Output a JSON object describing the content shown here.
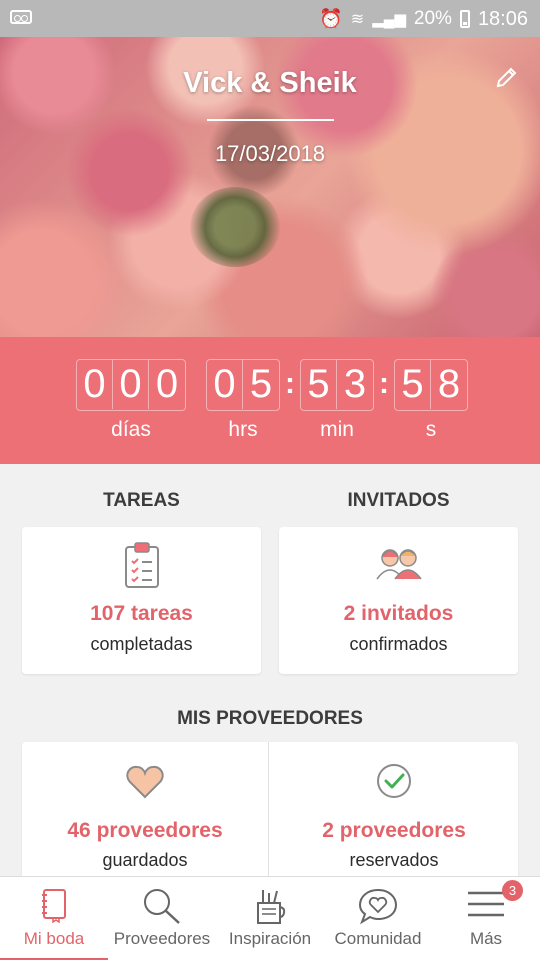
{
  "status_bar": {
    "battery": "20%",
    "time": "18:06"
  },
  "hero": {
    "couple_names": "Vick & Sheik",
    "wedding_date": "17/03/2018"
  },
  "countdown": {
    "days": [
      "0",
      "0",
      "0"
    ],
    "hours": [
      "0",
      "5"
    ],
    "minutes": [
      "5",
      "3"
    ],
    "seconds": [
      "5",
      "8"
    ],
    "labels": {
      "days": "días",
      "hours": "hrs",
      "minutes": "min",
      "seconds": "s"
    }
  },
  "tasks": {
    "title": "TAREAS",
    "count": "107 tareas",
    "caption": "completadas"
  },
  "guests": {
    "title": "INVITADOS",
    "count": "2 invitados",
    "caption": "confirmados"
  },
  "vendors": {
    "title": "MIS PROVEEDORES",
    "saved_count": "46 proveedores",
    "saved_caption": "guardados",
    "booked_count": "2 proveedores",
    "booked_caption": "reservados"
  },
  "nav": {
    "items": [
      {
        "label": "Mi boda",
        "icon": "notebook-icon"
      },
      {
        "label": "Proveedores",
        "icon": "search-icon"
      },
      {
        "label": "Inspiración",
        "icon": "pencil-cup-icon"
      },
      {
        "label": "Comunidad",
        "icon": "chat-heart-icon"
      },
      {
        "label": "Más",
        "icon": "menu-icon"
      }
    ],
    "more_badge": "3"
  },
  "colors": {
    "accent": "#ec7075",
    "text_accent": "#e2646a"
  }
}
